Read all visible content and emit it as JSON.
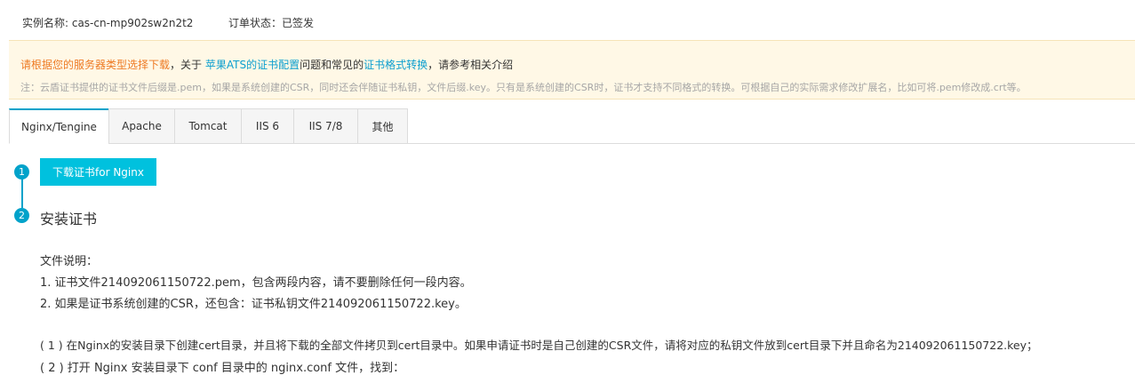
{
  "meta": {
    "instance_name": "实例名称: cas-cn-mp902sw2n2t2",
    "order_status": "订单状态：已签发"
  },
  "notice": {
    "part1": "请根据您的服务器类型选择下载",
    "part2": "，关于 ",
    "link1": "苹果ATS的证书配置",
    "part3": "问题和常见的",
    "link2": "证书格式转换",
    "part4": "，请参考相关介绍",
    "note": "注：云盾证书提供的证书文件后缀是.pem，如果是系统创建的CSR，同时还会伴随证书私钥，文件后缀.key。只有是系统创建的CSR时，证书才支持不同格式的转换。可根据自己的实际需求修改扩展名，比如可将.pem修改成.crt等。"
  },
  "tabs": [
    {
      "label": "Nginx/Tengine",
      "active": true
    },
    {
      "label": "Apache"
    },
    {
      "label": "Tomcat"
    },
    {
      "label": "IIS 6"
    },
    {
      "label": "IIS 7/8"
    },
    {
      "label": "其他"
    }
  ],
  "steps": {
    "step1_number": "1",
    "step2_number": "2",
    "download_label": "下载证书for Nginx",
    "step2_title": "安装证书"
  },
  "content": {
    "file_desc_title": "文件说明：",
    "line1": "1. 证书文件214092061150722.pem，包含两段内容，请不要删除任何一段内容。",
    "line2": "2. 如果是证书系统创建的CSR，还包含：证书私钥文件214092061150722.key。",
    "line3": "( 1 ) 在Nginx的安装目录下创建cert目录，并且将下载的全部文件拷贝到cert目录中。如果申请证书时是自己创建的CSR文件，请将对应的私钥文件放到cert目录下并且命名为214092061150722.key；",
    "line4": "( 2 ) 打开 Nginx 安装目录下 conf 目录中的 nginx.conf 文件，找到："
  },
  "colors": {
    "accent": "#00a2ca",
    "button": "#00c1de",
    "notice_bg": "#fff8e6",
    "orange": "#ee7a23",
    "link": "#0c9fcf"
  }
}
